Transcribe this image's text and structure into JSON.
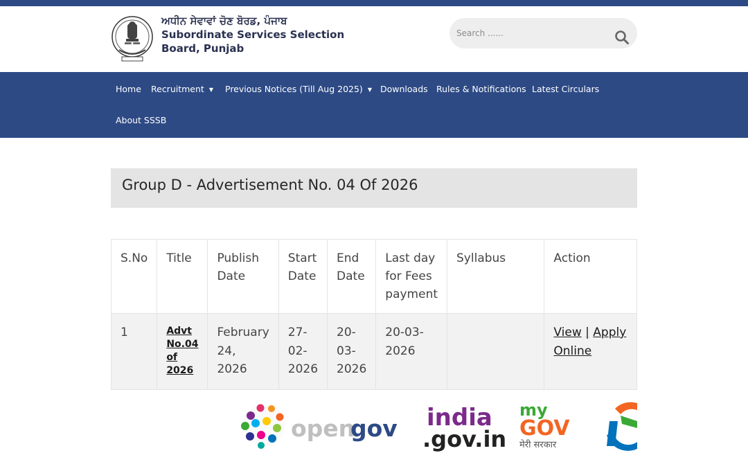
{
  "header": {
    "title_punjabi": "ਅਧੀਨ ਸੇਵਾਵਾਂ ਚੋਣ ਬੋਰਡ, ਪੰਜਾਬ",
    "title_english": "Subordinate Services Selection Board, Punjab",
    "emblem_icon": "state-emblem-icon"
  },
  "search": {
    "placeholder": "Search ......",
    "icon": "search-icon"
  },
  "nav": {
    "items": [
      {
        "label": "Home",
        "has_dropdown": false
      },
      {
        "label": "Recruitment",
        "has_dropdown": true
      },
      {
        "label": "Previous Notices (Till Aug 2025)",
        "has_dropdown": true
      },
      {
        "label": "Downloads",
        "has_dropdown": false
      },
      {
        "label": "Rules & Notifications",
        "has_dropdown": false
      },
      {
        "label": "Latest Circulars",
        "has_dropdown": false
      },
      {
        "label": "About SSSB",
        "has_dropdown": false
      }
    ],
    "caret": "▼"
  },
  "page": {
    "title": "Group D - Advertisement No. 04 Of 2026"
  },
  "table": {
    "headers": [
      "S.No",
      "Title",
      "Publish Date",
      "Start Date",
      "End Date",
      "Last day for Fees payment",
      "Syllabus",
      "Action"
    ],
    "rows": [
      {
        "sno": "1",
        "title": "Advt No.04 of 2026",
        "publish_date": "February 24, 2026",
        "start_date": "27-02-2026",
        "end_date": "20-03-2026",
        "last_fee_day": "20-03-2026",
        "syllabus": "",
        "action_view": "View",
        "action_separator": "|",
        "action_apply": "Apply Online"
      }
    ]
  },
  "footer_logos": {
    "opengov": {
      "text": "opengov",
      "prefix": "open",
      "suffix": "gov"
    },
    "indiagov": {
      "line1": "india",
      "line2": ".gov.in"
    },
    "mygov": {
      "line1": "my",
      "line2": "GOV",
      "tagline": "मेरी सरकार"
    },
    "colors": {
      "navy": "#2d4a85",
      "saffron": "#f26522",
      "green": "#3aa935",
      "purple": "#7b2a8c"
    }
  },
  "colors": {
    "primary": "#2d4a85",
    "title_box": "#e4e4e4",
    "row_bg": "#f2f2f2"
  }
}
